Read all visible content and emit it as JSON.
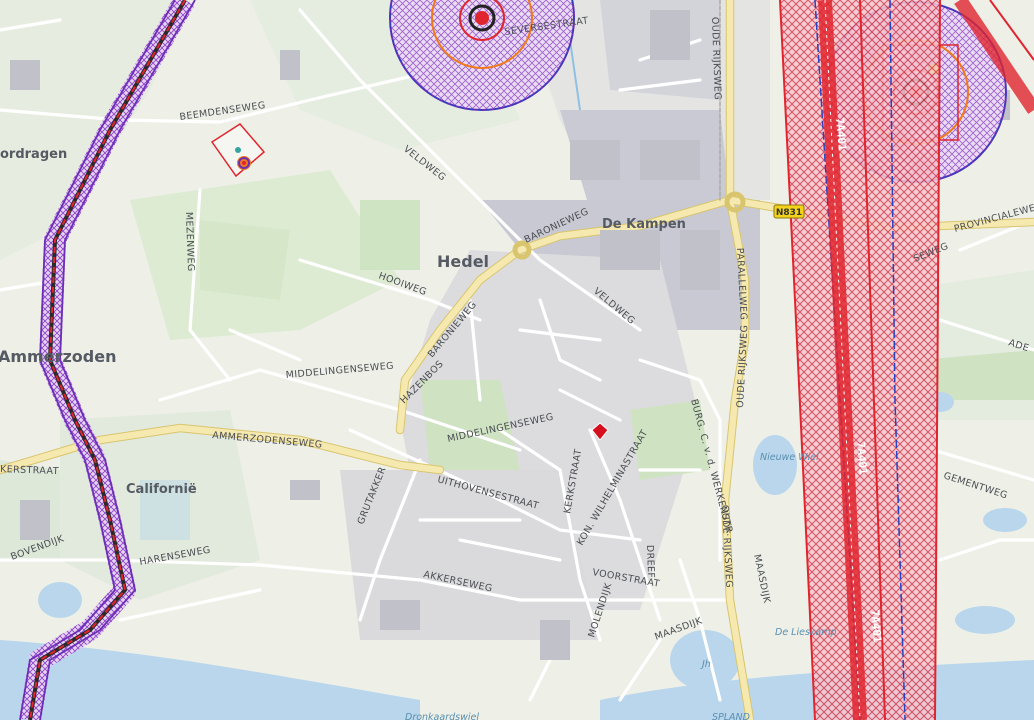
{
  "places": {
    "hedel": "Hedel",
    "de_kampen": "De Kampen",
    "ammerzoden": "Ammerzoden",
    "californie": "Californië",
    "ordragen": "ordragen"
  },
  "streets": {
    "beemdenseweg": "BEEMDENSEWEG",
    "veldweg_n": "VELDWEG",
    "veldweg_s": "VELDWEG",
    "mezenweg": "MEZENWEG",
    "hooiweg": "HOOIWEG",
    "baronieweg_n": "BARONIEWEG",
    "baronieweg_w": "BARONIEWEG",
    "oude_rijksweg_n": "OUDE RIJKSWEG",
    "oude_rijksweg_m": "OUDE RIJKSWEG",
    "oude_rijksweg_s": "OUDE RIJKSWEG",
    "parallelweg": "PARALLELWEG",
    "provincialeweg": "PROVINCIALEWEG",
    "middelingenseweg_w": "MIDDELINGENSEWEG",
    "middelingenseweg_e": "MIDDELINGENSEWEG",
    "hazenbos": "HAZENBOS",
    "ammerzodenseweg": "AMMERZODENSEWEG",
    "kerkstraat": "KERKSTRAAT",
    "kon_wilhelminastraat": "KON. WILHELMINASTRAAT",
    "burg": "BURG. C. v. d. WERKENSTR.",
    "uithovensestraat": "UITHOVENSESTRAAT",
    "grutakker": "GRUTAKKER",
    "harenseweg": "HARENSEWEG",
    "bovendijk": "BOVENDIJK",
    "akkerseweg": "AKKERSEWEG",
    "voorstraat": "VOORSTRAAT",
    "dreef": "DREEF",
    "maasdijk_s": "MAASDIJK",
    "maasdijk_e": "MAASDIJK",
    "molendijk": "MOLENDIJK",
    "gementweg": "GEMENTWEG",
    "karstraat": "KERSTRAAT",
    "ade": "ADE",
    "sevenstraat": "SEVERSESTRAAT",
    "seweg": "SEWEG"
  },
  "water": {
    "nieuwe_wiel": "Nieuwe Wiel",
    "de_lieskamp": "De Lieskamp",
    "dronkaardswiel": "Dronkaardswiel",
    "maas": "SPLAND"
  },
  "pipelines": {
    "upper_a": "7A401",
    "upper_b": "7A401",
    "lower": "7A401"
  },
  "road_shield": "N831",
  "map_label_jh": "Jh",
  "colors": {
    "background": "#f2f2ee",
    "agri": "#dde9d3",
    "grass": "#cde2c0",
    "urban": "#d9d9dc",
    "industrial": "#c9cad3",
    "water": "#b7d4ec",
    "major_road": "#f4e6a6",
    "pipeline_red": "#e0252e",
    "pipeline_blue": "#2742c2",
    "hazard_purple": "#6b2fb5",
    "hazard_orange": "#f07a1a",
    "marker": "#d60f1e"
  }
}
